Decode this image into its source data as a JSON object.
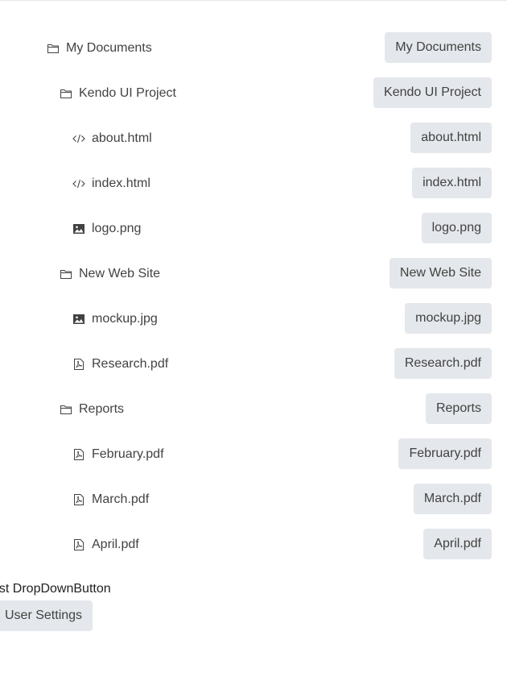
{
  "tree": {
    "items": [
      {
        "label": "My Documents",
        "icon": "folder-icon",
        "level": 0
      },
      {
        "label": "Kendo UI Project",
        "icon": "folder-icon",
        "level": 1
      },
      {
        "label": "about.html",
        "icon": "code-icon",
        "level": 2
      },
      {
        "label": "index.html",
        "icon": "code-icon",
        "level": 2
      },
      {
        "label": "logo.png",
        "icon": "image-icon",
        "level": 2
      },
      {
        "label": "New Web Site",
        "icon": "folder-icon",
        "level": 1
      },
      {
        "label": "mockup.jpg",
        "icon": "image-icon",
        "level": 2
      },
      {
        "label": "Research.pdf",
        "icon": "pdf-icon",
        "level": 2
      },
      {
        "label": "Reports",
        "icon": "folder-icon",
        "level": 1
      },
      {
        "label": "February.pdf",
        "icon": "pdf-icon",
        "level": 2
      },
      {
        "label": "March.pdf",
        "icon": "pdf-icon",
        "level": 2
      },
      {
        "label": "April.pdf",
        "icon": "pdf-icon",
        "level": 2
      }
    ]
  },
  "footer": {
    "label": "est DropDownButton",
    "button_label": "User Settings"
  },
  "colors": {
    "button_bg": "#e4e7eb",
    "text": "#424242"
  }
}
